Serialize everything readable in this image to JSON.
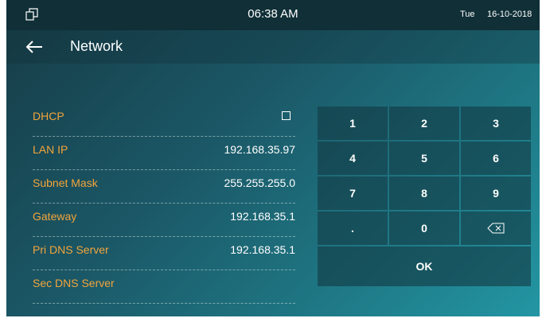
{
  "status_bar": {
    "icon": "multi-window-icon",
    "time": "06:38 AM",
    "day": "Tue",
    "date": "16-10-2018"
  },
  "title_bar": {
    "back_icon": "back-arrow-icon",
    "title": "Network"
  },
  "form": {
    "dhcp_label": "DHCP",
    "dhcp_checked": false,
    "lan_ip_label": "LAN IP",
    "lan_ip_value": "192.168.35.97",
    "subnet_mask_label": "Subnet Mask",
    "subnet_mask_value": "255.255.255.0",
    "gateway_label": "Gateway",
    "gateway_value": "192.168.35.1",
    "pri_dns_label": "Pri DNS Server",
    "pri_dns_value": "192.168.35.1",
    "sec_dns_label": "Sec DNS Server",
    "sec_dns_value": ""
  },
  "keypad": {
    "keys": [
      "1",
      "2",
      "3",
      "4",
      "5",
      "6",
      "7",
      "8",
      "9",
      ".",
      "0"
    ],
    "backspace_icon": "backspace-icon",
    "ok_label": "OK"
  },
  "colors": {
    "label": "#f2a53b",
    "status_bar_bg": "#102f37",
    "key_bg": "#123a44"
  }
}
